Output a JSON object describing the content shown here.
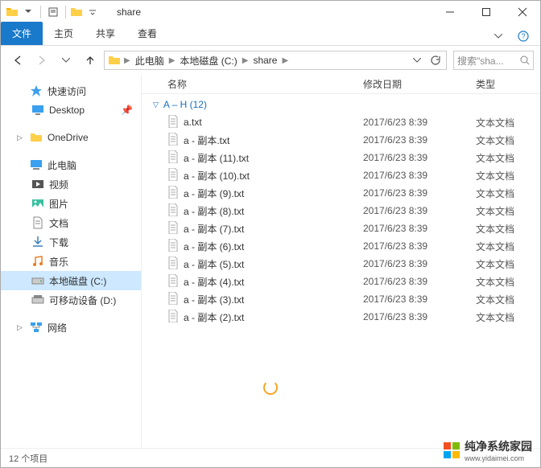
{
  "window": {
    "title": "share"
  },
  "ribbon": {
    "file_tab": "文件",
    "home_tab": "主页",
    "share_tab": "共享",
    "view_tab": "查看"
  },
  "breadcrumb": {
    "items": [
      "此电脑",
      "本地磁盘 (C:)",
      "share"
    ]
  },
  "search": {
    "placeholder": "搜索\"sha..."
  },
  "sidebar": {
    "quick_access": "快速访问",
    "desktop": "Desktop",
    "onedrive": "OneDrive",
    "this_pc": "此电脑",
    "videos": "视频",
    "pictures": "图片",
    "documents": "文档",
    "downloads": "下载",
    "music": "音乐",
    "local_disk_c": "本地磁盘 (C:)",
    "removable_d": "可移动设备 (D:)",
    "network": "网络"
  },
  "columns": {
    "name": "名称",
    "date": "修改日期",
    "type": "类型"
  },
  "group": {
    "label": "A – H (12)"
  },
  "files": [
    {
      "name": "a.txt",
      "date": "2017/6/23 8:39",
      "type": "文本文档"
    },
    {
      "name": "a - 副本.txt",
      "date": "2017/6/23 8:39",
      "type": "文本文档"
    },
    {
      "name": "a - 副本 (11).txt",
      "date": "2017/6/23 8:39",
      "type": "文本文档"
    },
    {
      "name": "a - 副本 (10).txt",
      "date": "2017/6/23 8:39",
      "type": "文本文档"
    },
    {
      "name": "a - 副本 (9).txt",
      "date": "2017/6/23 8:39",
      "type": "文本文档"
    },
    {
      "name": "a - 副本 (8).txt",
      "date": "2017/6/23 8:39",
      "type": "文本文档"
    },
    {
      "name": "a - 副本 (7).txt",
      "date": "2017/6/23 8:39",
      "type": "文本文档"
    },
    {
      "name": "a - 副本 (6).txt",
      "date": "2017/6/23 8:39",
      "type": "文本文档"
    },
    {
      "name": "a - 副本 (5).txt",
      "date": "2017/6/23 8:39",
      "type": "文本文档"
    },
    {
      "name": "a - 副本 (4).txt",
      "date": "2017/6/23 8:39",
      "type": "文本文档"
    },
    {
      "name": "a - 副本 (3).txt",
      "date": "2017/6/23 8:39",
      "type": "文本文档"
    },
    {
      "name": "a - 副本 (2).txt",
      "date": "2017/6/23 8:39",
      "type": "文本文档"
    }
  ],
  "status": {
    "item_count": "12 个项目"
  },
  "watermark": {
    "text": "纯净系统家园",
    "url": "www.yidaimei.com"
  }
}
